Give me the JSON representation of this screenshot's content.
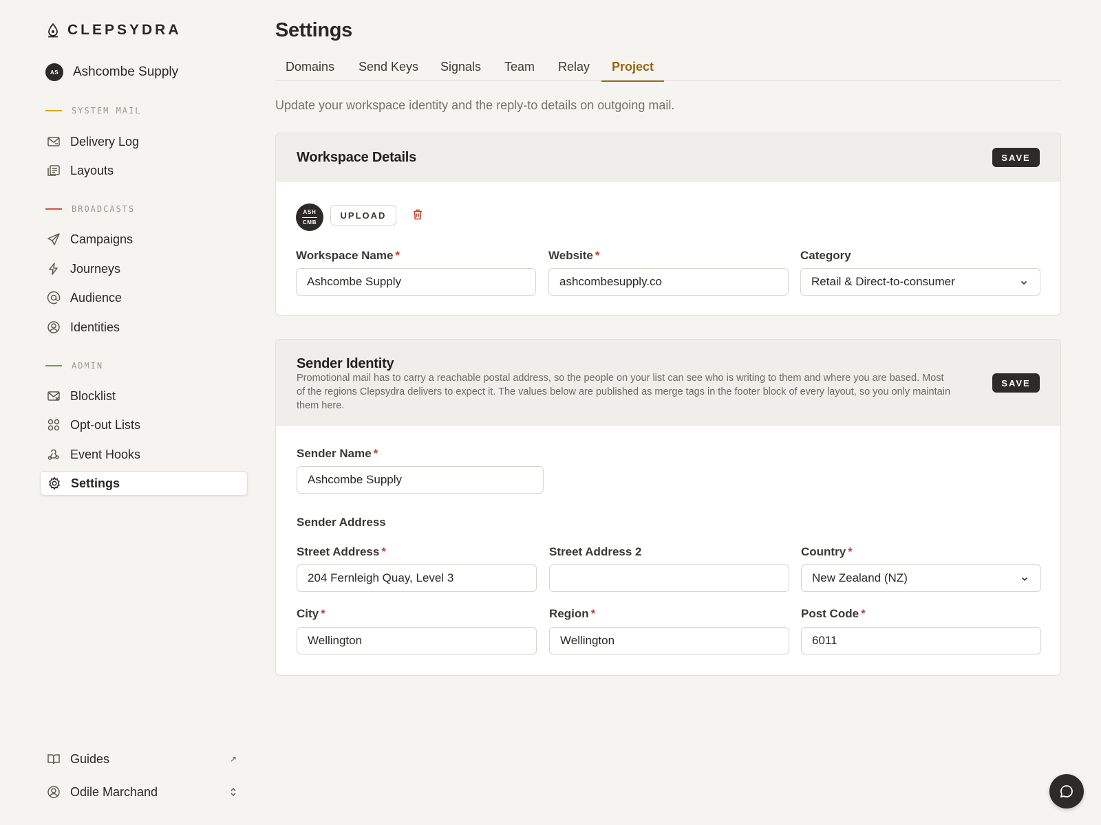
{
  "app": {
    "brand": "CLEPSYDRA"
  },
  "workspace": {
    "name": "Ashcombe Supply",
    "initials": "AS"
  },
  "sidebar": {
    "sections": [
      {
        "label": "SYSTEM MAIL",
        "color": "#e3a21a"
      },
      {
        "label": "BROADCASTS",
        "color": "#d9523a"
      },
      {
        "label": "ADMIN",
        "color": "#7d9a3c"
      }
    ],
    "items": [
      {
        "label": "Delivery Log",
        "icon": "mail-log-icon"
      },
      {
        "label": "Layouts",
        "icon": "layouts-icon"
      },
      {
        "label": "Campaigns",
        "icon": "send-icon"
      },
      {
        "label": "Journeys",
        "icon": "lightning-icon"
      },
      {
        "label": "Audience",
        "icon": "at-sign-icon"
      },
      {
        "label": "Identities",
        "icon": "user-circle-icon"
      },
      {
        "label": "Blocklist",
        "icon": "mail-block-icon"
      },
      {
        "label": "Opt-out Lists",
        "icon": "grid-dots-icon"
      },
      {
        "label": "Event Hooks",
        "icon": "webhook-icon"
      },
      {
        "label": "Settings",
        "icon": "gear-icon",
        "active": true
      }
    ],
    "footer": [
      {
        "label": "Guides",
        "icon": "book-icon",
        "trail": "↗"
      },
      {
        "label": "Odile Marchand",
        "icon": "user-circle-icon",
        "trail": "⌃⌄"
      }
    ]
  },
  "page": {
    "title": "Settings",
    "description": "Update your workspace identity and the reply-to details on outgoing mail.",
    "tabs": [
      {
        "label": "Domains"
      },
      {
        "label": "Send Keys"
      },
      {
        "label": "Signals"
      },
      {
        "label": "Team"
      },
      {
        "label": "Relay"
      },
      {
        "label": "Project",
        "active": true
      }
    ]
  },
  "workspace_card": {
    "title": "Workspace Details",
    "save_label": "SAVE",
    "logo_line1": "ASH",
    "logo_line2": "CMB",
    "upload_label": "UPLOAD",
    "fields": {
      "name": {
        "label": "Workspace Name",
        "value": "Ashcombe Supply",
        "required": "*"
      },
      "website": {
        "label": "Website",
        "value": "ashcombesupply.co",
        "required": "*"
      },
      "category": {
        "label": "Category",
        "value": "Retail & Direct-to-consumer"
      }
    }
  },
  "sender_card": {
    "title": "Sender Identity",
    "description": "Promotional mail has to carry a reachable postal address, so the people on your list can see who is writing to them and where you are based. Most of the regions Clepsydra delivers to expect it. The values below are published as merge tags in the footer block of every layout, so you only maintain them here.",
    "save_label": "SAVE",
    "sender_name": {
      "label": "Sender Name",
      "value": "Ashcombe Supply",
      "required": "*"
    },
    "address_heading": "Sender Address",
    "street1": {
      "label": "Street Address",
      "value": "204 Fernleigh Quay, Level 3",
      "required": "*"
    },
    "street2": {
      "label": "Street Address 2",
      "value": ""
    },
    "country": {
      "label": "Country",
      "value": "New Zealand (NZ)",
      "required": "*"
    },
    "city": {
      "label": "City",
      "value": "Wellington",
      "required": "*"
    },
    "region": {
      "label": "Region",
      "value": "Wellington",
      "required": "*"
    },
    "postcode": {
      "label": "Post Code",
      "value": "6011",
      "required": "*"
    }
  },
  "colors": {
    "accent": "#9a6412",
    "danger": "#c0442e",
    "dark": "#2c2b27"
  }
}
